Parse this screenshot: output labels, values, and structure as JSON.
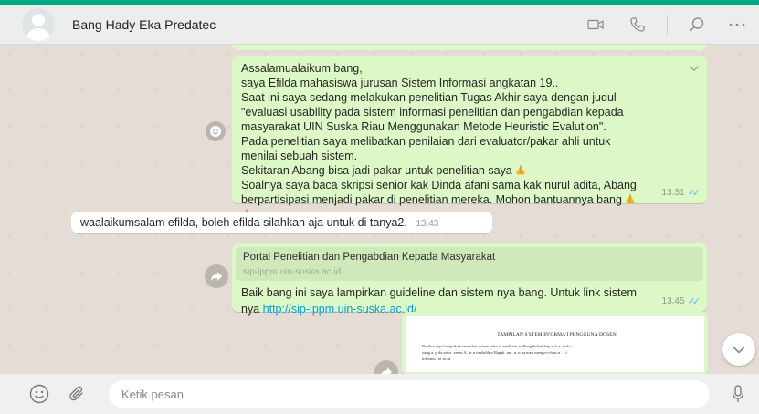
{
  "header": {
    "contact_name": "Bang Hady Eka Predatec",
    "icons": [
      "video-call-icon",
      "voice-call-icon",
      "search-icon",
      "more-icon"
    ]
  },
  "messages": [
    {
      "direction": "outgoing",
      "lines": [
        "Assalamualaikum bang,",
        "saya Efilda mahasiswa jurusan Sistem Informasi angkatan 19..",
        "Saat ini saya sedang melakukan penelitian Tugas Akhir saya dengan judul",
        "\"evaluasi usability pada sistem informasi penelitian dan pengabdian kepada",
        "masyarakat UIN Suska Riau Menggunakan Metode Heuristic Evalution\".",
        "Pada penelitian saya melibatkan penilaian dari evaluator/pakar ahli untuk",
        "menilai sebuah sistem.",
        "Sekitaran Abang bisa jadi pakar untuk penelitian saya",
        "Soalnya saya baca skripsi senior kak Dinda afani sama kak nurul adita, Abang",
        "berpartisipasi menjadi pakar di penelitian mereka. Mohon bantuannya bang"
      ],
      "time": "13.31"
    },
    {
      "direction": "incoming",
      "text": "waalaikumsalam efilda, boleh efilda silahkan aja untuk di tanya2.",
      "time": "13.43"
    },
    {
      "direction": "outgoing",
      "preview_title": "Portal Penelitian dan Pengabdian Kepada Masyarakat",
      "preview_url": "sip-lppm.uin-suska.ac.id",
      "line1": "Baik bang ini saya lampirkan guideline dan sistem nya bang. Untuk link sistem",
      "line2_prefix": "nya ",
      "link": "http://sip-lppm.uin-suska.ac.id/",
      "time": "13.45"
    },
    {
      "direction": "outgoing",
      "doc_title": "TAMPILAN S'STEM IN'ORMA'I PENGGUNA DOSEN",
      "doc_line1": "Berikut saya lampirkan tampilan sistem infor  si  enelitian  an Pengabdian kep  a  ,b  a, arak t",
      "doc_line2": "yang a.  p da setor .ereen  A, ar n tmelalih n Bapak .an  . n   .n ua men    mengev-duas n  . s i",
      "doc_line3": "informa.i te se.ut."
    }
  ],
  "footer": {
    "placeholder": "Ketik pesan"
  },
  "colors": {
    "outgoing_bubble": "#dcf8c6",
    "incoming_bubble": "#ffffff",
    "chat_background": "#e5ddd5",
    "read_ticks": "#4fc3f7",
    "link": "#039be5"
  }
}
